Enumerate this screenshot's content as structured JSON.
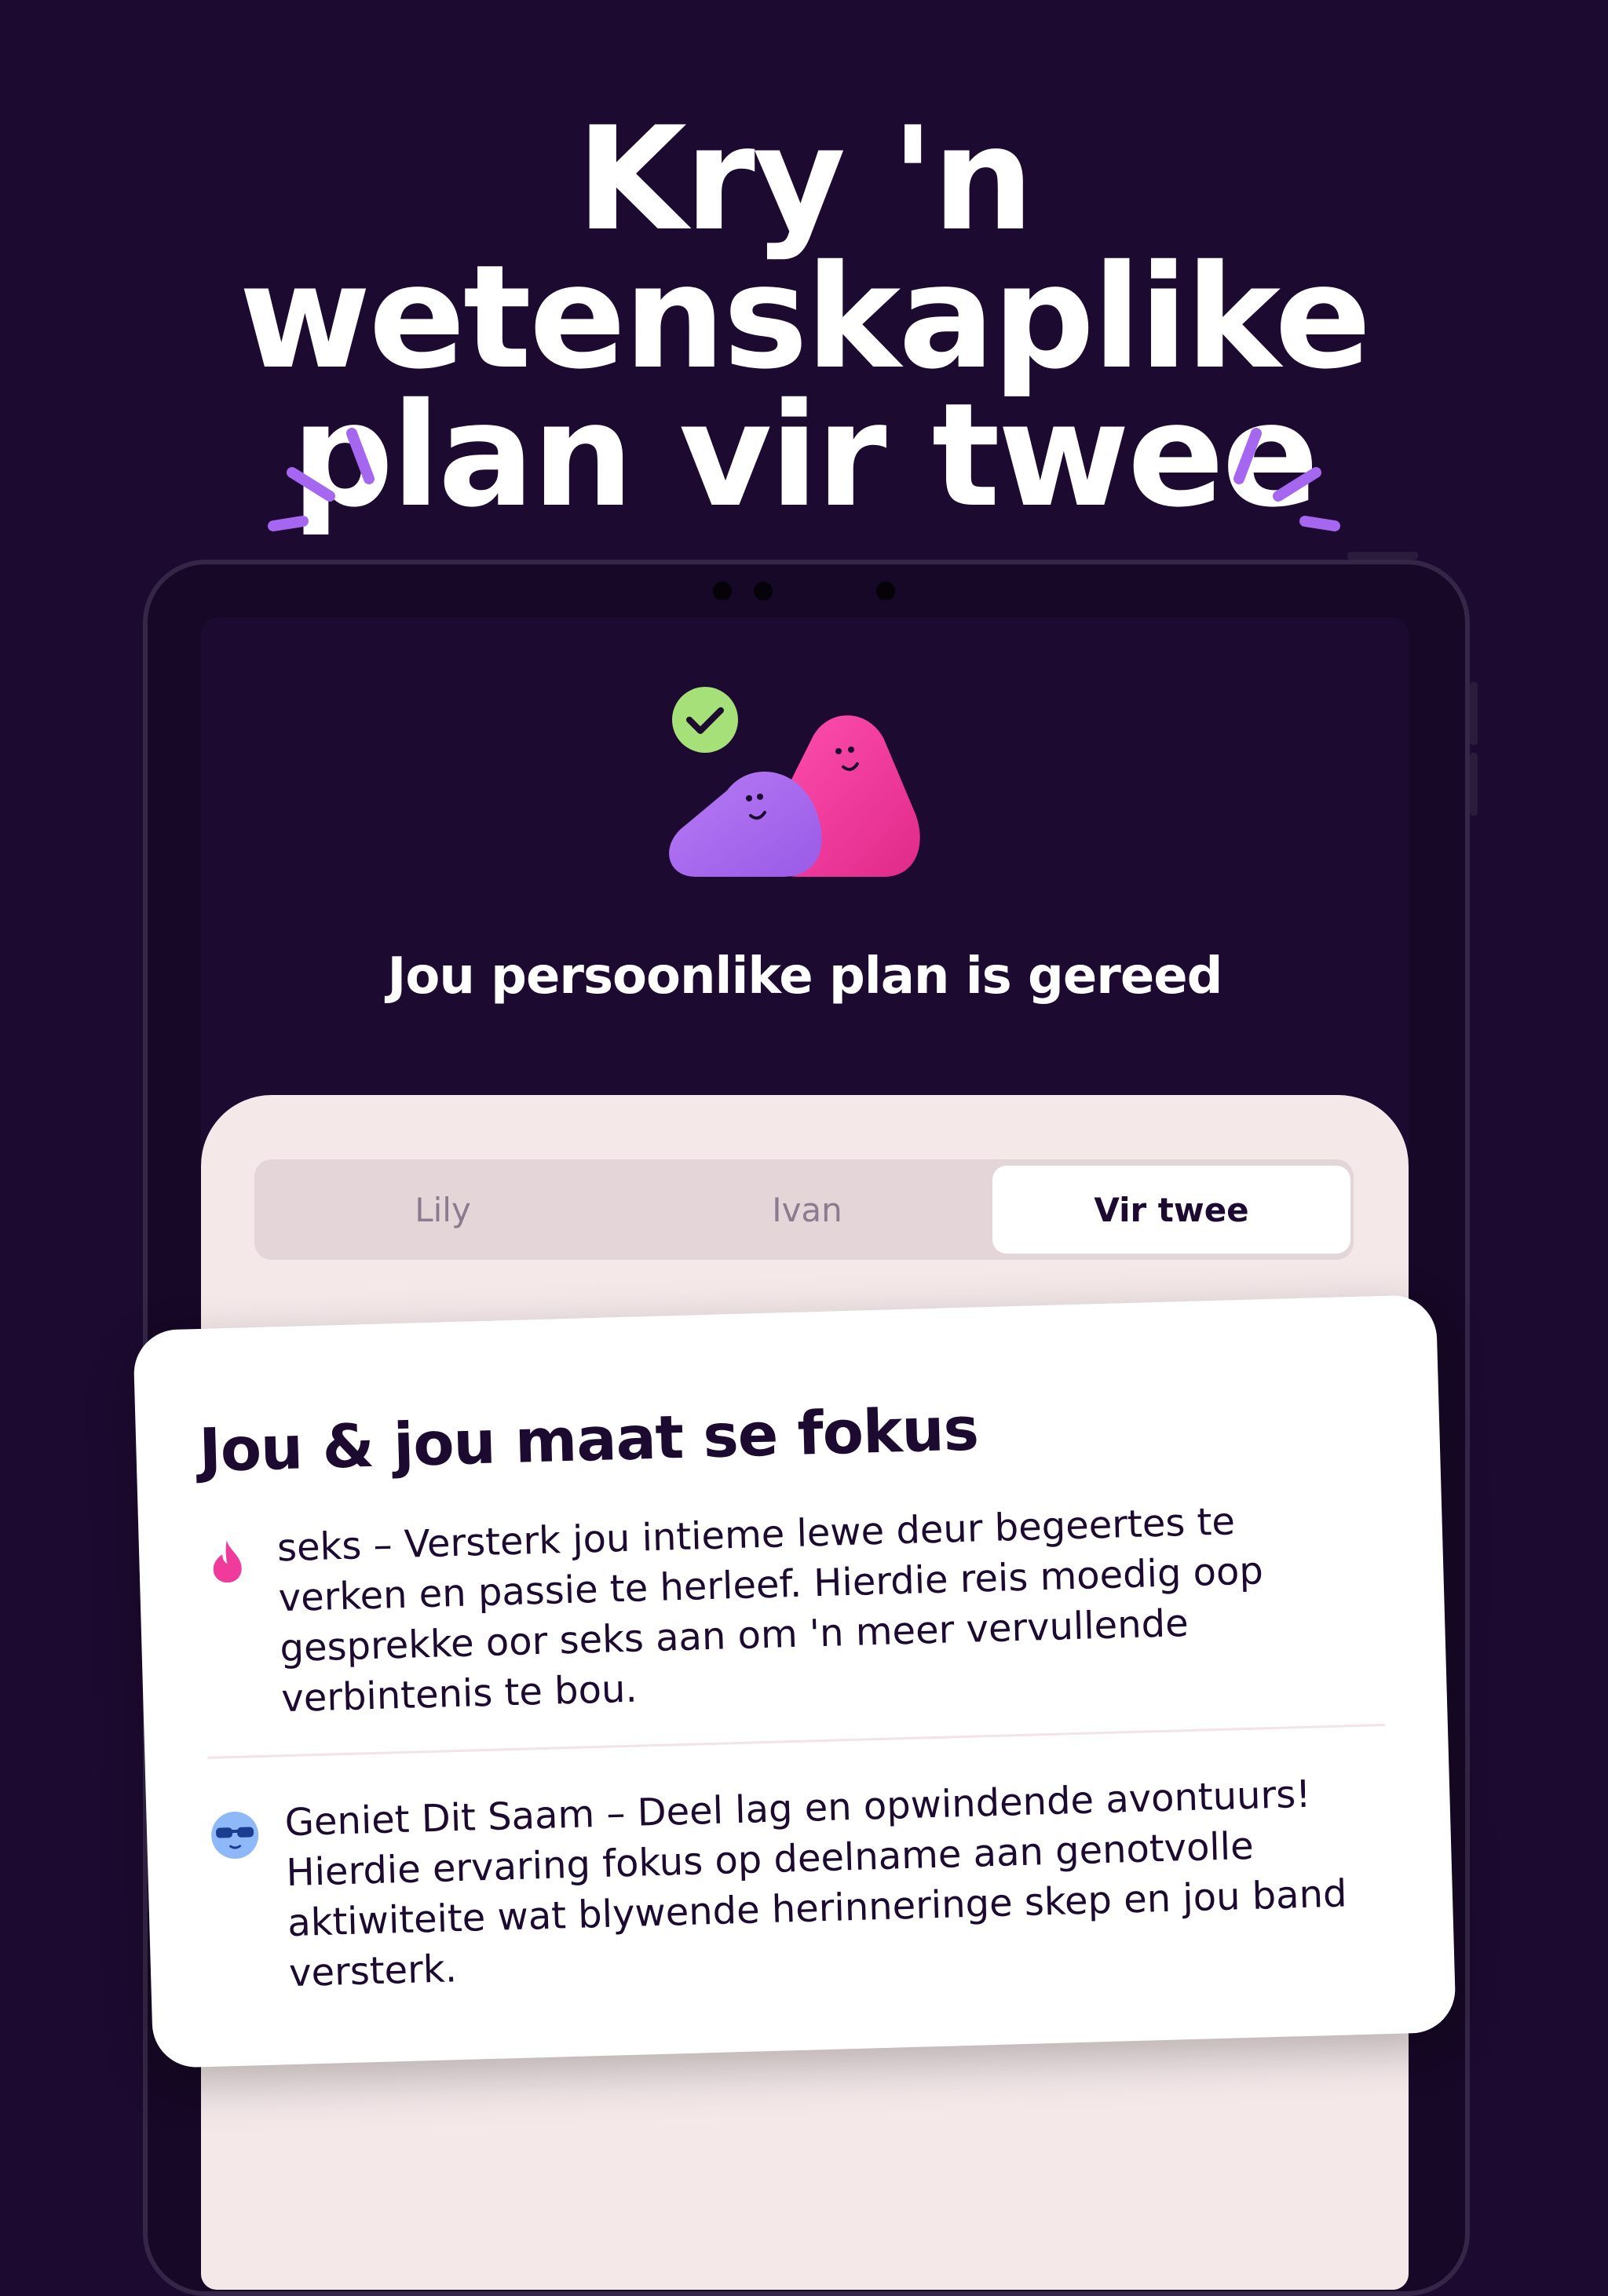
{
  "headline": {
    "line1": "Kry 'n wetenskaplike",
    "line2": "plan vir twee"
  },
  "screen": {
    "title": "Jou persoonlike plan is gereed",
    "tabs": [
      {
        "label": "Lily",
        "active": false
      },
      {
        "label": "Ivan",
        "active": false
      },
      {
        "label": "Vir twee",
        "active": true
      }
    ]
  },
  "card": {
    "title": "Jou & jou maat se fokus",
    "items": [
      {
        "icon": "flame-icon",
        "text": "seks – Versterk jou intieme lewe deur begeertes te verken en passie te herleef. Hierdie reis moedig oop gesprekke oor seks aan om 'n meer vervullende verbintenis te bou."
      },
      {
        "icon": "sunglasses-face-icon",
        "text": "Geniet Dit Saam – Deel lag en opwindende avontuurs! Hierdie ervaring fokus op deelname aan genotvolle aktiwiteite wat blywende herinneringe skep en jou band versterk."
      }
    ]
  },
  "colors": {
    "background": "#1d0a30",
    "accent": "#a566f0",
    "pink": "#f03a9c",
    "check": "#a5e078",
    "sheet": "#f4e8e9"
  }
}
